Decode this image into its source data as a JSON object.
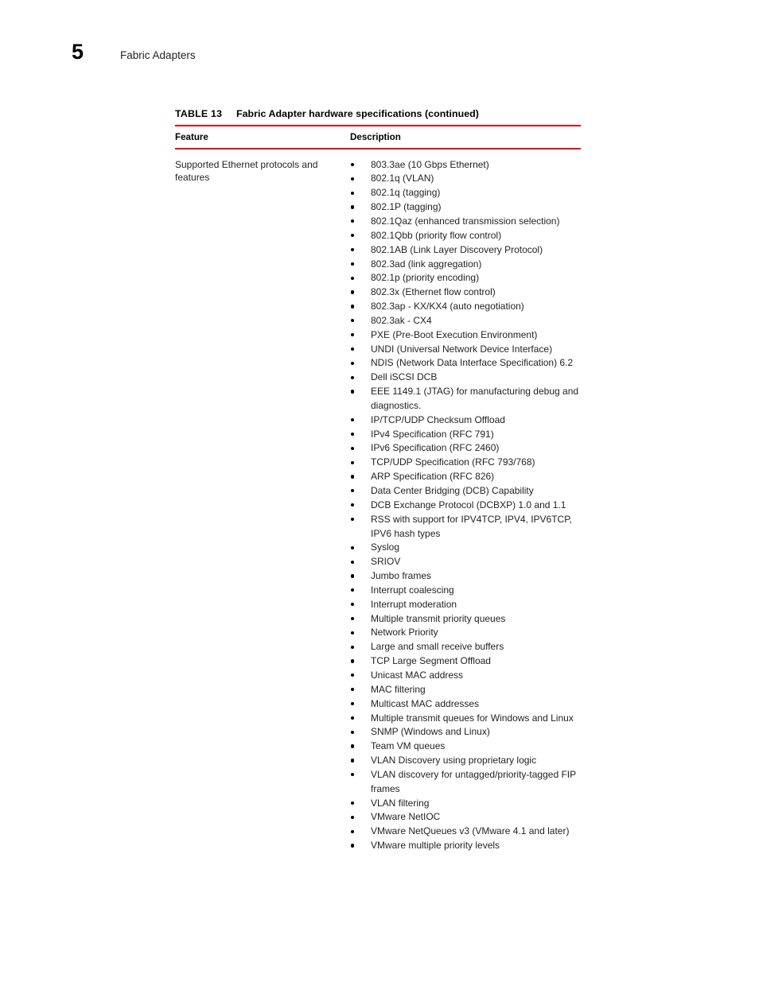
{
  "page": {
    "chapter_number": "5",
    "chapter_title": "Fabric Adapters"
  },
  "colors": {
    "rule_red": "#e3001b",
    "body_text": "#231f20",
    "bullet": "#000000"
  },
  "table": {
    "caption_label": "TABLE 13",
    "caption_text": "Fabric Adapter hardware specifications  (continued)",
    "columns": [
      {
        "key": "feature",
        "header": "Feature"
      },
      {
        "key": "description",
        "header": "Description"
      }
    ],
    "rows": [
      {
        "feature": "Supported Ethernet protocols and features",
        "description_bullets": [
          "803.3ae (10 Gbps Ethernet)",
          "802.1q (VLAN)",
          "802.1q (tagging)",
          "802.1P (tagging)",
          "802.1Qaz (enhanced transmission selection)",
          "802.1Qbb (priority flow control)",
          "802.1AB (Link Layer Discovery Protocol)",
          "802.3ad (link aggregation)",
          "802.1p (priority encoding)",
          "802.3x (Ethernet flow control)",
          "802.3ap - KX/KX4 (auto negotiation)",
          "802.3ak - CX4",
          "PXE (Pre-Boot Execution Environment)",
          "UNDI (Universal Network Device Interface)",
          "NDIS (Network Data Interface Specification) 6.2",
          "Dell iSCSI DCB",
          "EEE 1149.1 (JTAG) for manufacturing debug and diagnostics.",
          "IP/TCP/UDP Checksum Offload",
          "IPv4 Specification (RFC 791)",
          "IPv6 Specification (RFC 2460)",
          "TCP/UDP Specification (RFC 793/768)",
          "ARP Specification (RFC 826)",
          "Data Center Bridging (DCB) Capability",
          "DCB Exchange Protocol (DCBXP) 1.0 and 1.1",
          "RSS with support for IPV4TCP, IPV4, IPV6TCP, IPV6 hash types",
          "Syslog",
          "SRIOV",
          "Jumbo frames",
          "Interrupt coalescing",
          "Interrupt moderation",
          "Multiple transmit priority queues",
          "Network Priority",
          "Large and small receive buffers",
          "TCP Large Segment Offload",
          "Unicast MAC address",
          "MAC filtering",
          "Multicast MAC addresses",
          "Multiple transmit queues for Windows and Linux",
          "SNMP (Windows and Linux)",
          "Team VM queues",
          "VLAN Discovery using proprietary logic",
          "VLAN discovery for untagged/priority-tagged FIP frames",
          "VLAN filtering",
          "VMware NetIOC",
          "VMware NetQueues v3 (VMware 4.1 and later)",
          "VMware multiple priority levels"
        ]
      }
    ]
  }
}
